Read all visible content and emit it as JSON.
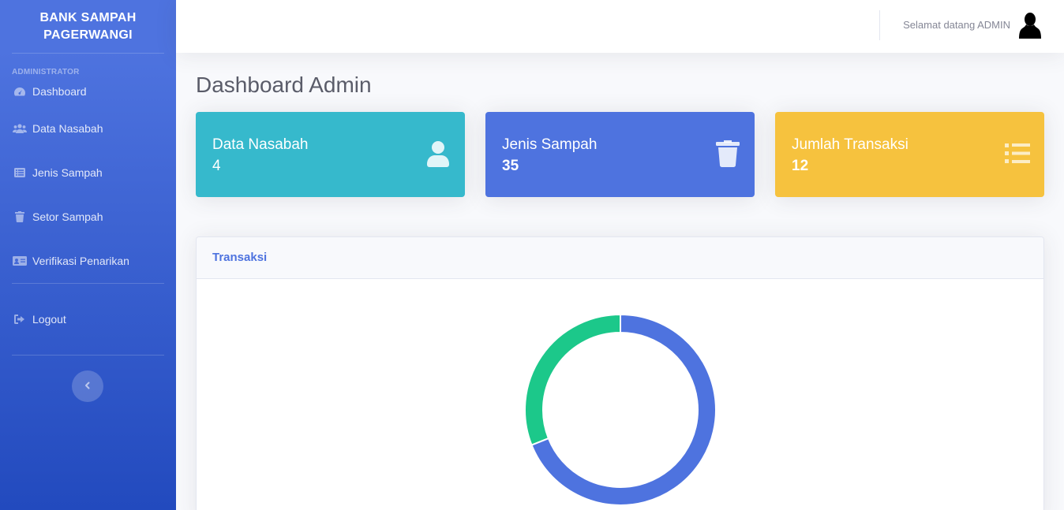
{
  "sidebar": {
    "brand": "BANK SAMPAH PAGERWANGI",
    "heading": "ADMINISTRATOR",
    "items": [
      {
        "label": "Dashboard",
        "icon": "tachometer-icon"
      },
      {
        "label": "Data Nasabah",
        "icon": "users-icon"
      },
      {
        "label": "Jenis Sampah",
        "icon": "list-alt-icon"
      },
      {
        "label": "Setor Sampah",
        "icon": "trash-icon"
      },
      {
        "label": "Verifikasi Penarikan",
        "icon": "id-card-icon"
      }
    ],
    "logout": "Logout"
  },
  "topbar": {
    "welcome": "Selamat datang ADMIN"
  },
  "page_title": "Dashboard Admin",
  "cards": [
    {
      "label": "Data Nasabah",
      "value": "4",
      "color": "#36b9cc",
      "icon": "user-icon"
    },
    {
      "label": "Jenis Sampah",
      "value": "35",
      "color": "#4e73df",
      "icon": "trash-icon"
    },
    {
      "label": "Jumlah Transaksi",
      "value": "12",
      "color": "#f6c23e",
      "icon": "list-icon"
    }
  ],
  "panel": {
    "title": "Transaksi"
  },
  "chart_data": {
    "type": "pie",
    "style": "doughnut",
    "values": [
      0.69,
      0.31
    ],
    "colors": [
      "#4e73df",
      "#1cc88a"
    ]
  }
}
